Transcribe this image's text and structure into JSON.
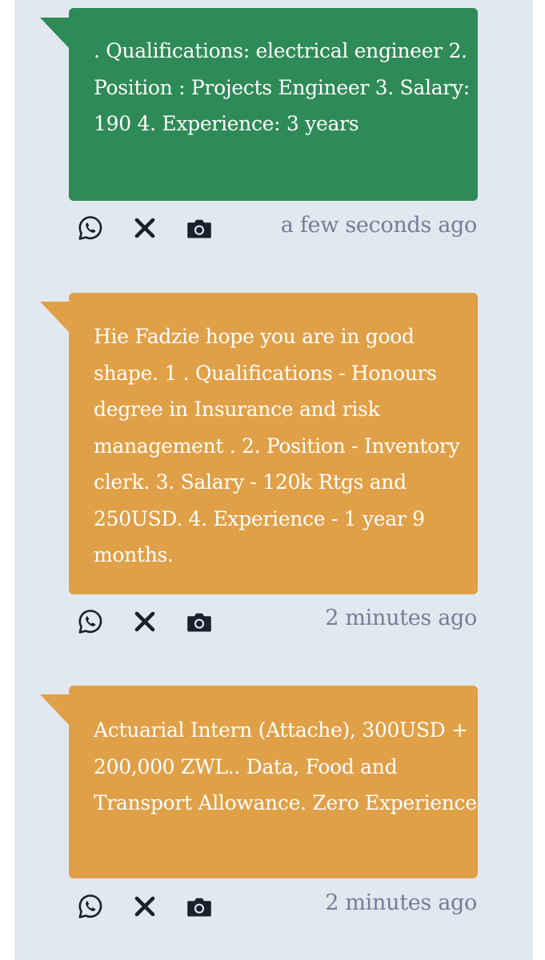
{
  "messages": [
    {
      "text": ". Qualifications: electrical engineer 2. Position : Projects Engineer 3. Salary: 190 4. Experience: 3 years",
      "color": "#2e8b57",
      "time": "a few seconds ago"
    },
    {
      "text": "Hie Fadzie hope you are in good shape. 1 . Qualifications - Honours degree in Insurance and risk management . 2. Position - Inventory clerk. 3. Salary - 120k Rtgs and 250USD. 4. Experience - 1 year 9 months.",
      "color": "#e0a048",
      "time": "2 minutes ago"
    },
    {
      "text": "Actuarial Intern (Attache), 300USD + 200,000 ZWL.. Data, Food and Transport Allowance. Zero Experience",
      "color": "#e0a048",
      "time": "2 minutes ago"
    }
  ],
  "actions": {
    "whatsapp_icon": "whatsapp-icon",
    "close_icon": "close-icon",
    "camera_icon": "camera-icon"
  }
}
